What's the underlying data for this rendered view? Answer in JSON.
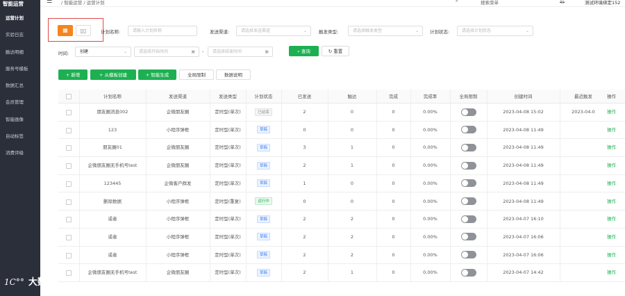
{
  "sidebar": {
    "title": "智能运营",
    "items": [
      {
        "label": "运营计划",
        "active": true
      },
      {
        "label": "实验日志",
        "active": false
      },
      {
        "label": "触达明细",
        "active": false
      },
      {
        "label": "服务号模板",
        "active": false
      },
      {
        "label": "数据汇总",
        "active": false
      },
      {
        "label": "会员管理",
        "active": false
      },
      {
        "label": "智能画像",
        "active": false
      },
      {
        "label": "自动标签",
        "active": false
      },
      {
        "label": "消费评级",
        "active": false
      }
    ],
    "logo_mark": "1C°°",
    "logo_text": "大数跨境"
  },
  "header": {
    "breadcrumb": "/ 智能运营 / 运营计划",
    "search_text": "搜索菜单",
    "user_text": "测试环境绑定152"
  },
  "filters": {
    "plan_name": {
      "label": "计划名称:",
      "placeholder": "请输入计划名称"
    },
    "channel": {
      "label": "发送渠道:",
      "placeholder": "请选择发送渠道"
    },
    "trigger_type": {
      "label": "触发类型:",
      "placeholder": "请选择触发类型"
    },
    "plan_status": {
      "label": "计划状态:",
      "placeholder": "请选择计划状态"
    },
    "time": {
      "label": "时间:",
      "value": "创建",
      "start_placeholder": "请选择开始时间",
      "separator": "-",
      "end_placeholder": "请选择结束时间"
    },
    "query_button": "查询",
    "reset_button": "重置"
  },
  "toolbar": {
    "add": "新增",
    "from_template": "从模板创建",
    "smart_generate": "智能生成",
    "global_limit": "全局限制",
    "data_explain": "数据说明"
  },
  "table": {
    "columns": [
      "计划名称",
      "发送渠道",
      "发送类型",
      "计划状态",
      "已发送",
      "触达",
      "完成",
      "完成率",
      "全局限制",
      "创建时间",
      "最近触发",
      "操作"
    ],
    "rows": [
      {
        "name": "朋友圈消息002",
        "channel": "企微朋友圈",
        "type": "定时型(单次)",
        "status": "已结束",
        "status_color": "gray",
        "sent": "2",
        "reach": "0",
        "done": "0",
        "rate": "0.00%",
        "created": "2023-04-08 15:02",
        "last": "2023-04-0",
        "op": "操作"
      },
      {
        "name": "123",
        "channel": "小程序弹框",
        "type": "定时型(单次)",
        "status": "草稿",
        "status_color": "blue",
        "sent": "0",
        "reach": "0",
        "done": "0",
        "rate": "0.00%",
        "created": "2023-04-08 11:49",
        "last": "",
        "op": "操作"
      },
      {
        "name": "朋友圈01",
        "channel": "企微朋友圈",
        "type": "定时型(单次)",
        "status": "草稿",
        "status_color": "blue",
        "sent": "3",
        "reach": "1",
        "done": "0",
        "rate": "0.00%",
        "created": "2023-04-08 11:49",
        "last": "",
        "op": "操作"
      },
      {
        "name": "企微朋友圈无手机号test",
        "channel": "企微朋友圈",
        "type": "定时型(单次)",
        "status": "草稿",
        "status_color": "blue",
        "sent": "2",
        "reach": "1",
        "done": "0",
        "rate": "0.00%",
        "created": "2023-04-08 11:49",
        "last": "",
        "op": "操作"
      },
      {
        "name": "123445",
        "channel": "企微客户群发",
        "type": "定时型(单次)",
        "status": "草稿",
        "status_color": "blue",
        "sent": "1",
        "reach": "0",
        "done": "0",
        "rate": "0.00%",
        "created": "2023-04-08 11:49",
        "last": "",
        "op": "操作"
      },
      {
        "name": "删除数据",
        "channel": "小程序弹框",
        "type": "定时型(重复)",
        "status": "运行中",
        "status_color": "green",
        "sent": "0",
        "reach": "0",
        "done": "0",
        "rate": "0.00%",
        "created": "2023-04-08 11:49",
        "last": "",
        "op": "操作"
      },
      {
        "name": "或者",
        "channel": "小程序弹框",
        "type": "定时型(单次)",
        "status": "草稿",
        "status_color": "blue",
        "sent": "2",
        "reach": "2",
        "done": "0",
        "rate": "0.00%",
        "created": "2023-04-07 16:10",
        "last": "",
        "op": "操作"
      },
      {
        "name": "或者",
        "channel": "小程序弹框",
        "type": "定时型(单次)",
        "status": "草稿",
        "status_color": "blue",
        "sent": "2",
        "reach": "2",
        "done": "0",
        "rate": "0.00%",
        "created": "2023-04-07 16:06",
        "last": "",
        "op": "操作"
      },
      {
        "name": "或者",
        "channel": "小程序弹框",
        "type": "定时型(单次)",
        "status": "草稿",
        "status_color": "blue",
        "sent": "2",
        "reach": "2",
        "done": "0",
        "rate": "0.00%",
        "created": "2023-04-07 16:06",
        "last": "",
        "op": "操作"
      },
      {
        "name": "企微朋友圈无手机号test",
        "channel": "企微朋友圈",
        "type": "定时型(单次)",
        "status": "草稿",
        "status_color": "blue",
        "sent": "2",
        "reach": "1",
        "done": "0",
        "rate": "0.00%",
        "created": "2023-04-07 14:42",
        "last": "",
        "op": "操作"
      }
    ]
  },
  "icons": {
    "menu": "menu-fold-icon",
    "search": "search-icon",
    "bell": "bell-icon",
    "layout_a": "table-view-icon",
    "layout_b": "card-view-icon",
    "calendar": "calendar-icon",
    "chevron": "chevron-down-icon",
    "refresh": "refresh-icon",
    "plus": "plus-icon"
  },
  "colors": {
    "accent_green": "#1db052",
    "accent_orange": "#f5841f",
    "sidebar_bg": "#2b2f3a",
    "highlight_red": "#e04848"
  }
}
